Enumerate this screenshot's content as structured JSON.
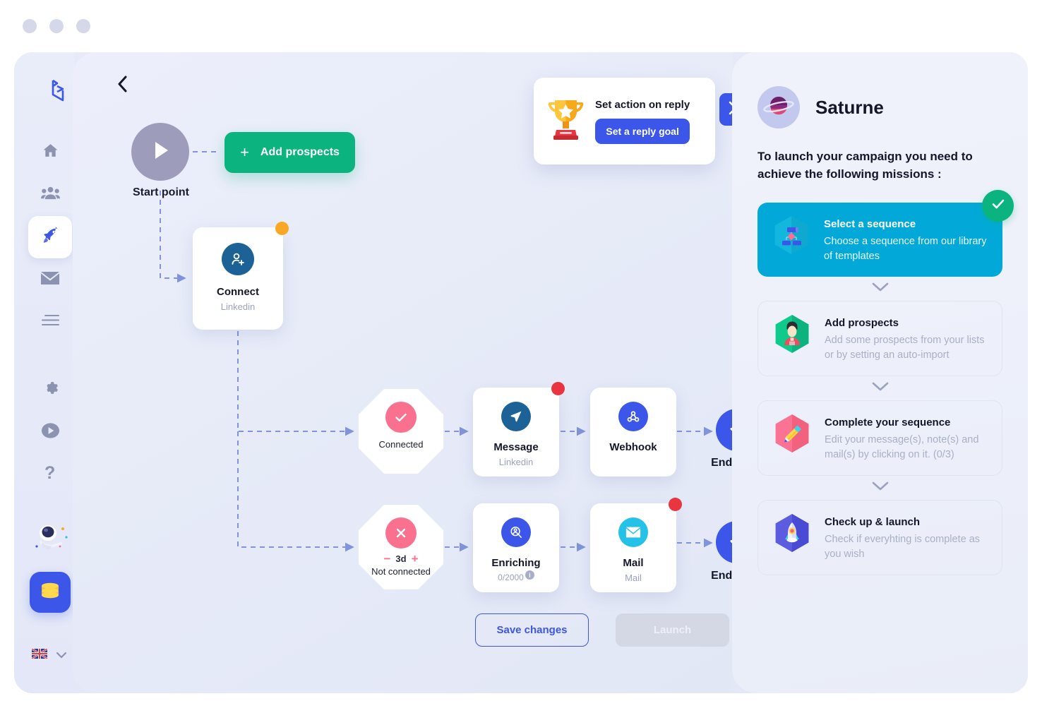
{
  "window": {
    "dots": [
      "close",
      "minimize",
      "maximize"
    ]
  },
  "rail": {
    "logo_icon": "waalaxy-logo-icon",
    "items": [
      {
        "name": "home",
        "icon": "home-icon",
        "active": false
      },
      {
        "name": "prospects",
        "icon": "people-icon",
        "active": false
      },
      {
        "name": "campaigns",
        "icon": "rocket-icon",
        "active": true
      },
      {
        "name": "inbox",
        "icon": "envelope-icon",
        "active": false
      },
      {
        "name": "queue",
        "icon": "list-lines-icon",
        "active": false
      },
      {
        "name": "settings",
        "icon": "gear-icon",
        "active": false
      },
      {
        "name": "tutorials",
        "icon": "play-circle-icon",
        "active": false
      },
      {
        "name": "help",
        "icon": "question-mark-icon",
        "active": false
      }
    ],
    "astronaut_icon": "astronaut-icon",
    "credits_icon": "coins-icon",
    "language": {
      "flag": "uk-flag-icon",
      "chevron": "chevron-down-icon"
    }
  },
  "canvas": {
    "back_icon": "chevron-left-icon",
    "start": {
      "label": "Start point",
      "icon": "play-icon"
    },
    "add_prospects": {
      "label": "Add prospects",
      "plus": "+"
    },
    "trophy": {
      "icon": "trophy-icon",
      "title": "Set action on reply",
      "button": "Set a reply goal"
    },
    "panel_toggle_icon": "chevron-right-icon",
    "nodes": {
      "connect": {
        "title": "Connect",
        "sub": "Linkedin",
        "icon": "person-add-icon",
        "badge": "orange"
      },
      "connected": {
        "label": "Connected",
        "icon": "check-icon"
      },
      "notconnected": {
        "label": "Not connected",
        "icon": "cross-icon",
        "delay": "3d",
        "minus": "−",
        "plus": "+"
      },
      "message": {
        "title": "Message",
        "sub": "Linkedin",
        "icon": "paper-plane-icon",
        "badge": "red"
      },
      "webhook": {
        "title": "Webhook",
        "sub": "",
        "icon": "webhook-icon",
        "badge": "none"
      },
      "enriching": {
        "title": "Enriching",
        "count": "0/2000",
        "icon": "person-search-icon",
        "badge": "none",
        "info": "i"
      },
      "mail": {
        "title": "Mail",
        "sub": "Mail",
        "icon": "envelope-icon",
        "badge": "red"
      },
      "endpoint1": {
        "label": "End point",
        "icon": "check-icon"
      },
      "endpoint2": {
        "label": "End point",
        "icon": "check-icon"
      }
    },
    "buttons": {
      "save": "Save changes",
      "launch": "Launch"
    }
  },
  "sidebar": {
    "avatar_icon": "planet-saturn-icon",
    "title": "Saturne",
    "description": "To launch your campaign you need to achieve the following missions :",
    "missions": [
      {
        "title": "Select a sequence",
        "subtitle": "Choose a sequence from our library of templates",
        "icon": "sequence-hex-icon",
        "state": "done",
        "check_icon": "check-icon"
      },
      {
        "title": "Add prospects",
        "subtitle": "Add some prospects from your lists or by setting an auto-import",
        "icon": "prospect-hex-icon",
        "state": "todo"
      },
      {
        "title": "Complete your sequence",
        "subtitle": "Edit your message(s), note(s) and mail(s) by clicking on it. (0/3)",
        "icon": "pencil-hex-icon",
        "state": "todo"
      },
      {
        "title": "Check up & launch",
        "subtitle": "Check if everyhting is complete as you wish",
        "icon": "rocket-hex-icon",
        "state": "todo"
      }
    ],
    "separator_icon": "chevron-down-icon"
  },
  "colors": {
    "accent_blue": "#3b56e8",
    "green": "#0bb37e",
    "cyan": "#02a9d8",
    "pink": "#f9718f",
    "orange": "#f9a825",
    "red": "#e8353f",
    "mail_cyan": "#24c2e8",
    "dark_blue": "#1d6296"
  }
}
